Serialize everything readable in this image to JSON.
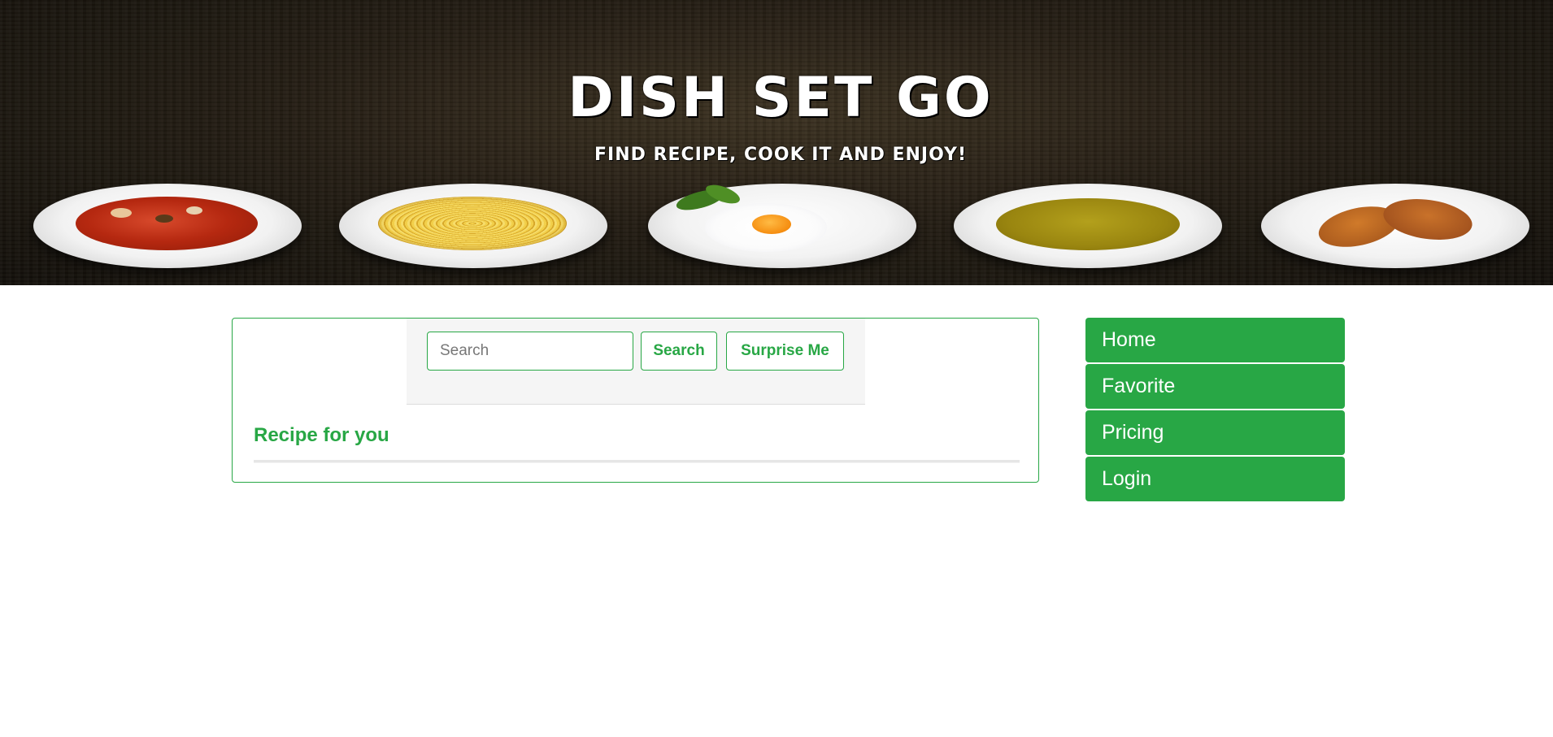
{
  "header": {
    "title": "DISH SET GO",
    "subtitle": "FIND RECIPE, COOK IT AND ENJOY!"
  },
  "search": {
    "placeholder": "Search",
    "value": "",
    "search_label": "Search",
    "surprise_label": "Surprise Me"
  },
  "content": {
    "section_title": "Recipe for you"
  },
  "nav": {
    "items": [
      {
        "label": "Home"
      },
      {
        "label": "Favorite"
      },
      {
        "label": "Pricing"
      },
      {
        "label": "Login"
      }
    ]
  },
  "colors": {
    "accent": "#28a745",
    "hero_background": "#1c1711"
  }
}
